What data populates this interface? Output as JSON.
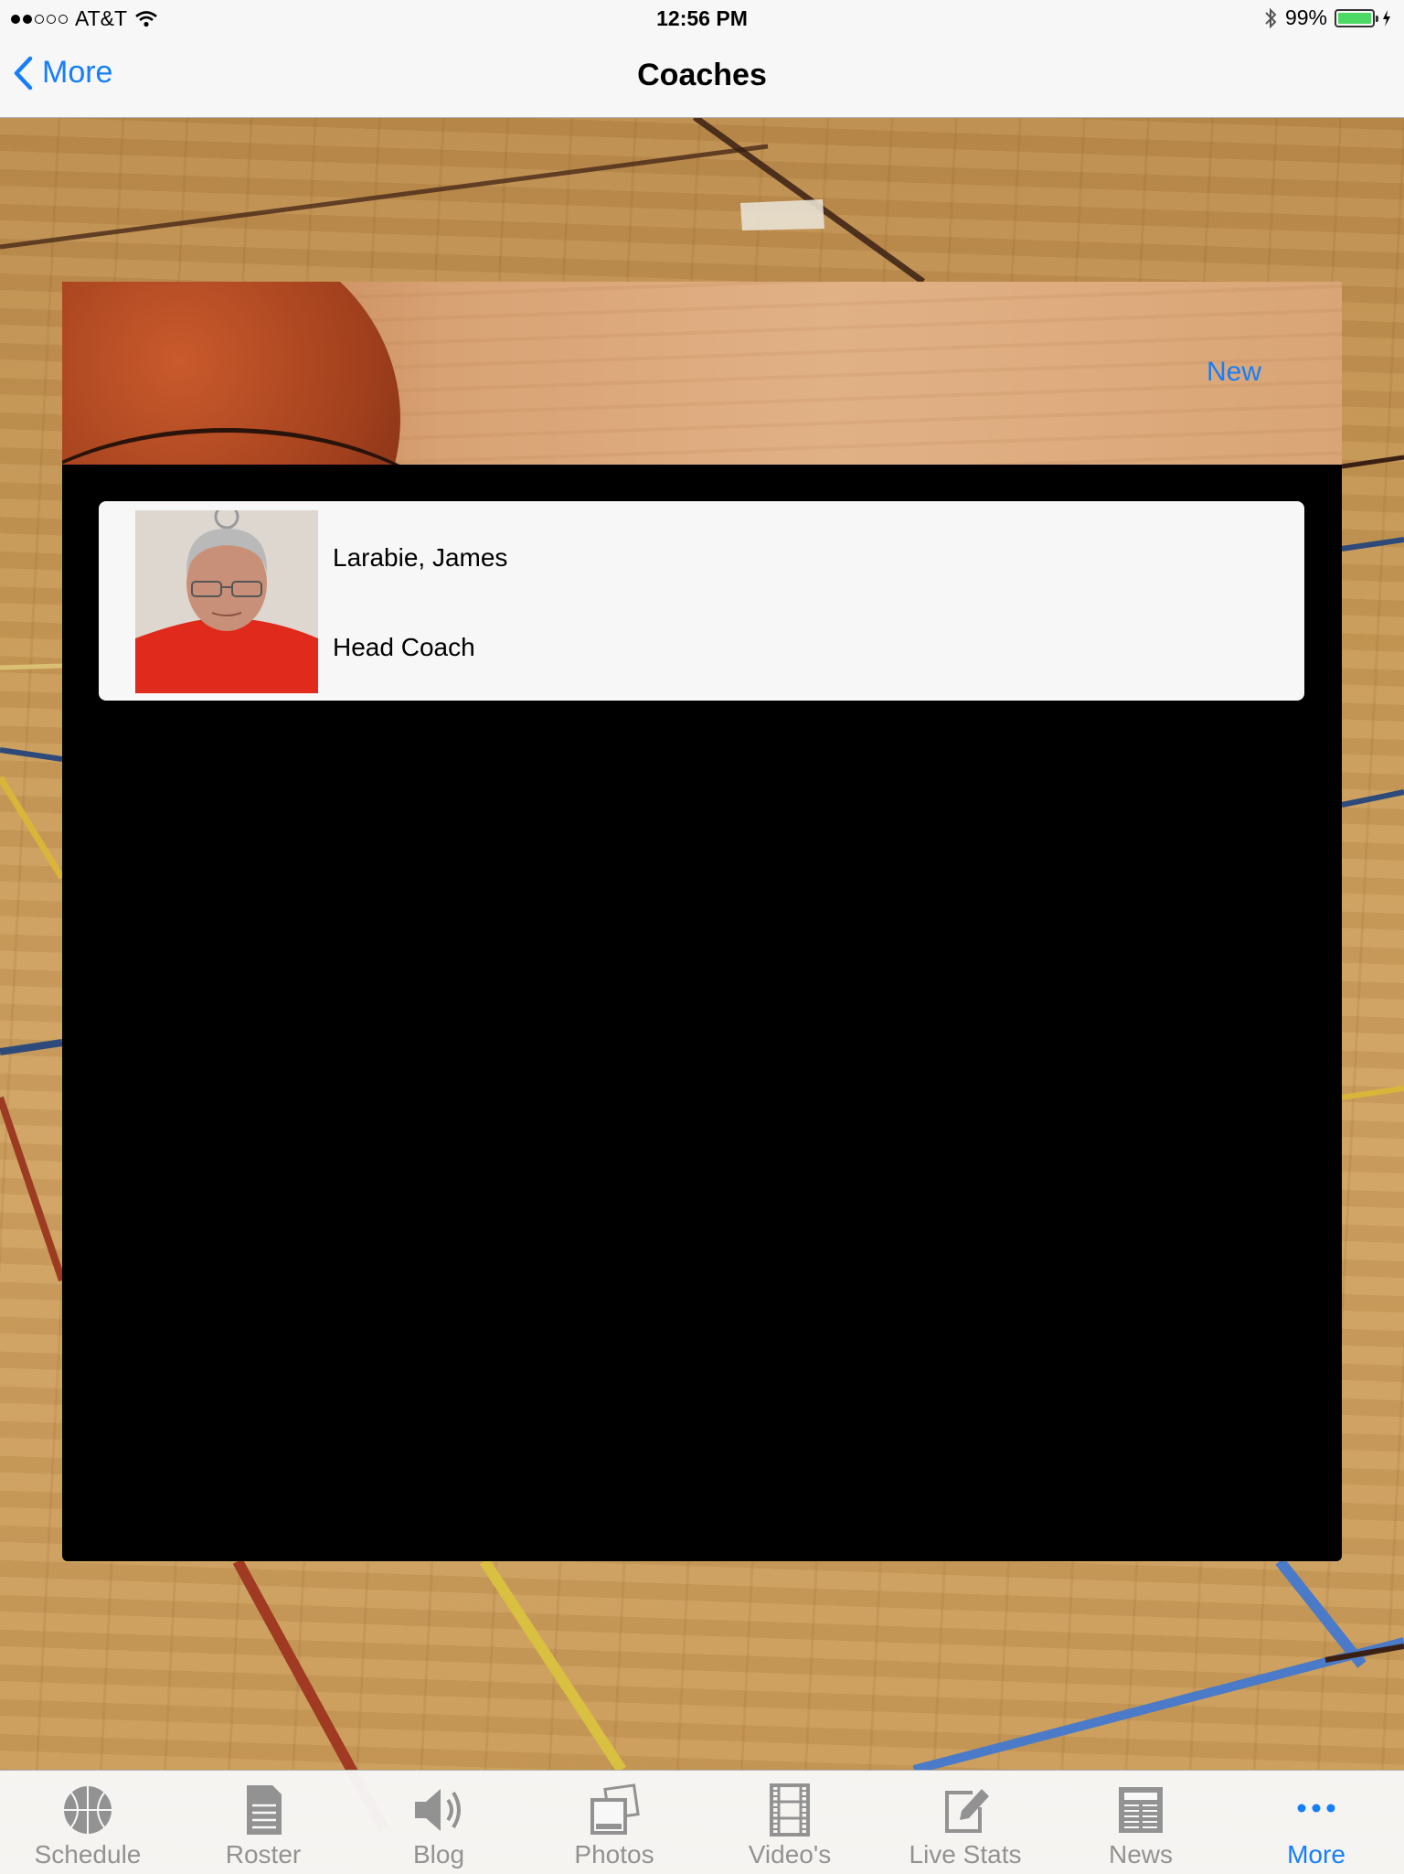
{
  "status_bar": {
    "carrier": "AT&T",
    "time": "12:56 PM",
    "battery": "99%"
  },
  "nav": {
    "back_label": "More",
    "title": "Coaches"
  },
  "banner": {
    "new_label": "New"
  },
  "coaches": [
    {
      "name": "Larabie, James",
      "role": "Head Coach"
    }
  ],
  "tabs": [
    {
      "label": "Schedule",
      "icon": "basketball-icon"
    },
    {
      "label": "Roster",
      "icon": "document-icon"
    },
    {
      "label": "Blog",
      "icon": "speaker-icon"
    },
    {
      "label": "Photos",
      "icon": "photos-icon"
    },
    {
      "label": "Video's",
      "icon": "film-icon"
    },
    {
      "label": "Live Stats",
      "icon": "edit-icon"
    },
    {
      "label": "News",
      "icon": "newspaper-icon"
    },
    {
      "label": "More",
      "icon": "more-dots-icon",
      "active": true
    }
  ],
  "colors": {
    "accent": "#157efb",
    "tab_inactive": "#929292",
    "panel": "#000000",
    "card": "#f7f7f7"
  }
}
